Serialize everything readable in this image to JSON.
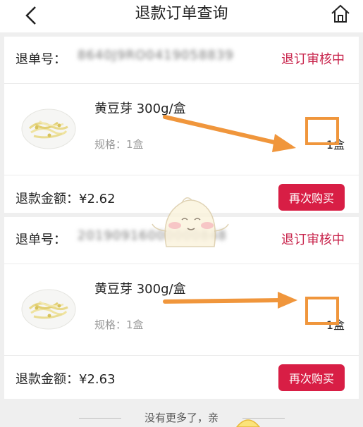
{
  "header": {
    "title": "退款订单查询",
    "back_icon": "chevron-left-icon",
    "home_icon": "home-icon"
  },
  "orders": [
    {
      "refund_no_label": "退单号：",
      "refund_no_value": "8640J9RO0419058839",
      "status": "退订审核中",
      "product_name": "黄豆芽 300g/盒",
      "spec": "规格：1盒",
      "qty": "1盒",
      "amount": "退款金额：¥2.62",
      "rebuy_label": "再次购买"
    },
    {
      "refund_no_label": "退单号：",
      "refund_no_value": "20190916000000848",
      "status": "退订审核中",
      "product_name": "黄豆芽 300g/盒",
      "spec": "规格：1盒",
      "qty": "1盒",
      "amount": "退款金额：¥2.63",
      "rebuy_label": "再次购买"
    }
  ],
  "footer": {
    "note": "没有更多了，亲"
  },
  "colors": {
    "status": "#c8234b",
    "button": "#d81e45",
    "annotation": "#f0963c"
  }
}
